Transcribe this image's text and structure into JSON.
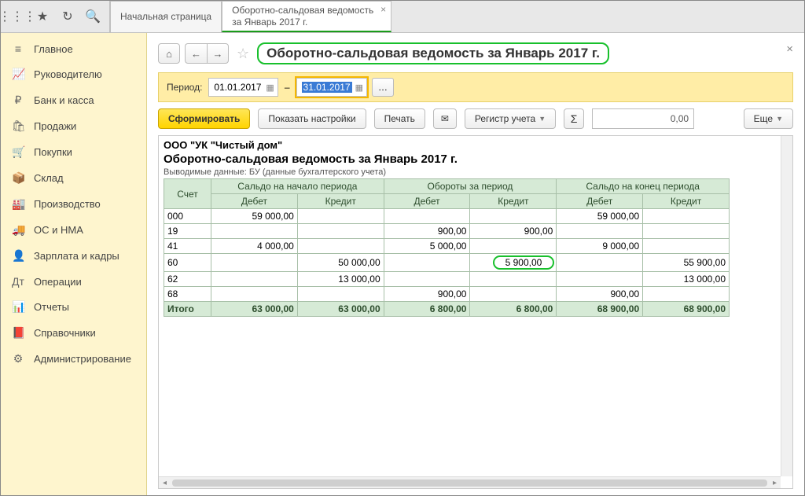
{
  "tabs": {
    "home": "Начальная страница",
    "report": "Оборотно-сальдовая ведомость за Январь 2017 г."
  },
  "sidebar": {
    "items": [
      {
        "icon": "≡",
        "label": "Главное"
      },
      {
        "icon": "📈",
        "label": "Руководителю"
      },
      {
        "icon": "₽",
        "label": "Банк и касса"
      },
      {
        "icon": "🛍",
        "label": "Продажи"
      },
      {
        "icon": "🛒",
        "label": "Покупки"
      },
      {
        "icon": "📦",
        "label": "Склад"
      },
      {
        "icon": "🏭",
        "label": "Производство"
      },
      {
        "icon": "🚚",
        "label": "ОС и НМА"
      },
      {
        "icon": "👤",
        "label": "Зарплата и кадры"
      },
      {
        "icon": "Дт",
        "label": "Операции"
      },
      {
        "icon": "📊",
        "label": "Отчеты"
      },
      {
        "icon": "📕",
        "label": "Справочники"
      },
      {
        "icon": "⚙",
        "label": "Администрирование"
      }
    ]
  },
  "page": {
    "title": "Оборотно-сальдовая ведомость за Январь 2017 г."
  },
  "period": {
    "label": "Период:",
    "from": "01.01.2017",
    "to": "31.01.2017"
  },
  "actions": {
    "form": "Сформировать",
    "settings": "Показать настройки",
    "print": "Печать",
    "register": "Регистр учета",
    "sum_value": "0,00",
    "more": "Еще"
  },
  "report": {
    "company": "ООО \"УК \"Чистый дом\"",
    "title": "Оборотно-сальдовая ведомость за Январь 2017 г.",
    "sub": "Выводимые данные:  БУ (данные бухгалтерского учета)",
    "headers": {
      "acct": "Счет",
      "start": "Сальдо на начало периода",
      "turn": "Обороты за период",
      "end": "Сальдо на конец периода",
      "debit": "Дебет",
      "credit": "Кредит"
    },
    "rows": [
      {
        "acct": "000",
        "sd": "59 000,00",
        "sc": "",
        "td": "",
        "tc": "",
        "ed": "59 000,00",
        "ec": ""
      },
      {
        "acct": "19",
        "sd": "",
        "sc": "",
        "td": "900,00",
        "tc": "900,00",
        "ed": "",
        "ec": ""
      },
      {
        "acct": "41",
        "sd": "4 000,00",
        "sc": "",
        "td": "5 000,00",
        "tc": "",
        "ed": "9 000,00",
        "ec": ""
      },
      {
        "acct": "60",
        "sd": "",
        "sc": "50 000,00",
        "td": "",
        "tc": "5 900,00",
        "ed": "",
        "ec": "55 900,00",
        "hl_tc": true
      },
      {
        "acct": "62",
        "sd": "",
        "sc": "13 000,00",
        "td": "",
        "tc": "",
        "ed": "",
        "ec": "13 000,00"
      },
      {
        "acct": "68",
        "sd": "",
        "sc": "",
        "td": "900,00",
        "tc": "",
        "ed": "900,00",
        "ec": ""
      }
    ],
    "total": {
      "label": "Итого",
      "sd": "63 000,00",
      "sc": "63 000,00",
      "td": "6 800,00",
      "tc": "6 800,00",
      "ed": "68 900,00",
      "ec": "68 900,00"
    }
  }
}
